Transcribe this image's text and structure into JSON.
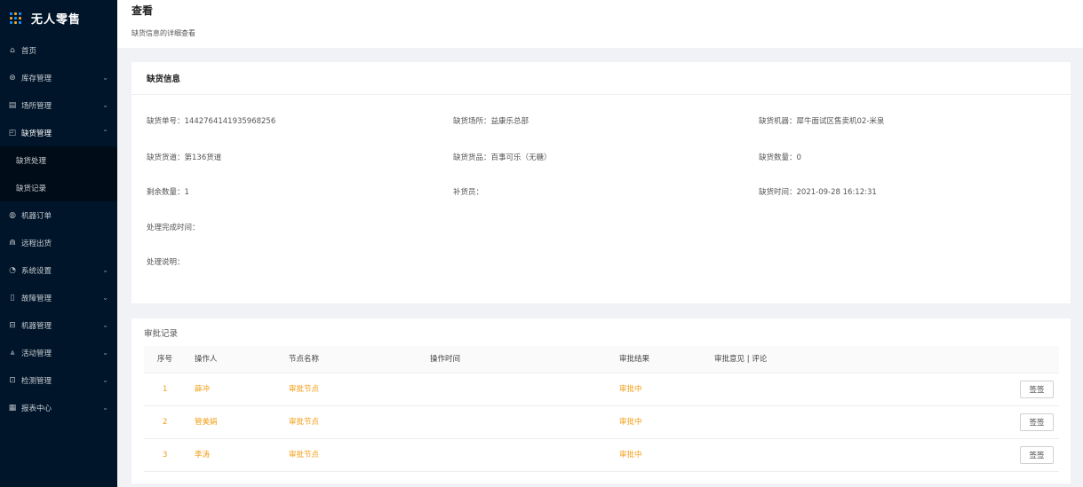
{
  "app": {
    "title": "无人零售"
  },
  "sidebar": {
    "items": [
      {
        "label": "首页",
        "icon": "home-icon",
        "glyph": "⌂",
        "chevron": ""
      },
      {
        "label": "库存管理",
        "icon": "inventory-icon",
        "glyph": "⊛",
        "chevron": "⌄"
      },
      {
        "label": "场所管理",
        "icon": "venue-icon",
        "glyph": "▤",
        "chevron": "⌄"
      },
      {
        "label": "缺货管理",
        "icon": "shortage-icon",
        "glyph": "◰",
        "chevron": "⌃"
      },
      {
        "label": "机器订单",
        "icon": "order-icon",
        "glyph": "◍",
        "chevron": ""
      },
      {
        "label": "远程出货",
        "icon": "remote-icon",
        "glyph": "⋒",
        "chevron": ""
      },
      {
        "label": "系统设置",
        "icon": "settings-icon",
        "glyph": "◔",
        "chevron": "⌄"
      },
      {
        "label": "故障管理",
        "icon": "fault-icon",
        "glyph": "▯",
        "chevron": "⌄"
      },
      {
        "label": "机器管理",
        "icon": "machine-icon",
        "glyph": "⊟",
        "chevron": "⌄"
      },
      {
        "label": "活动管理",
        "icon": "activity-icon",
        "glyph": "⩓",
        "chevron": "⌄"
      },
      {
        "label": "检测管理",
        "icon": "inspect-icon",
        "glyph": "⊡",
        "chevron": "⌄"
      },
      {
        "label": "报表中心",
        "icon": "report-icon",
        "glyph": "▦",
        "chevron": "⌄"
      }
    ],
    "subitems": [
      "缺货处理",
      "缺货记录"
    ]
  },
  "header": {
    "title": "查看",
    "subtitle": "缺货信息的详细查看"
  },
  "info": {
    "title": "缺货信息",
    "fields": {
      "order_no": "缺货单号：1442764141935968256",
      "place": "缺货场所：益康乐总部",
      "machine": "缺货机器：犀牛面试区售卖机02-米泉",
      "lane": "缺货货道：第136货道",
      "goods": "缺货货品：百事可乐（无糖）",
      "qty": "缺货数量：0",
      "remain": "剩余数量：1",
      "restocker": "补货员：",
      "time": "缺货时间：2021-09-28 16:12:31",
      "done_time": "处理完成时间：",
      "note": "处理说明："
    }
  },
  "approval": {
    "title": "审批记录",
    "columns": [
      "序号",
      "操作人",
      "节点名称",
      "操作时间",
      "审批结果",
      "审批意见 | 评论"
    ],
    "rows": [
      {
        "no": "1",
        "operator": "薛冲",
        "node": "审批节点",
        "time": "",
        "result": "审批中",
        "comment": "",
        "action": "签签"
      },
      {
        "no": "2",
        "operator": "管美娟",
        "node": "审批节点",
        "time": "",
        "result": "审批中",
        "comment": "",
        "action": "签签"
      },
      {
        "no": "3",
        "operator": "李涛",
        "node": "审批节点",
        "time": "",
        "result": "审批中",
        "comment": "",
        "action": "签签"
      }
    ]
  },
  "colors": {
    "sidebar_bg": "#001529",
    "accent": "#1890ff",
    "status": "#f39c12"
  }
}
